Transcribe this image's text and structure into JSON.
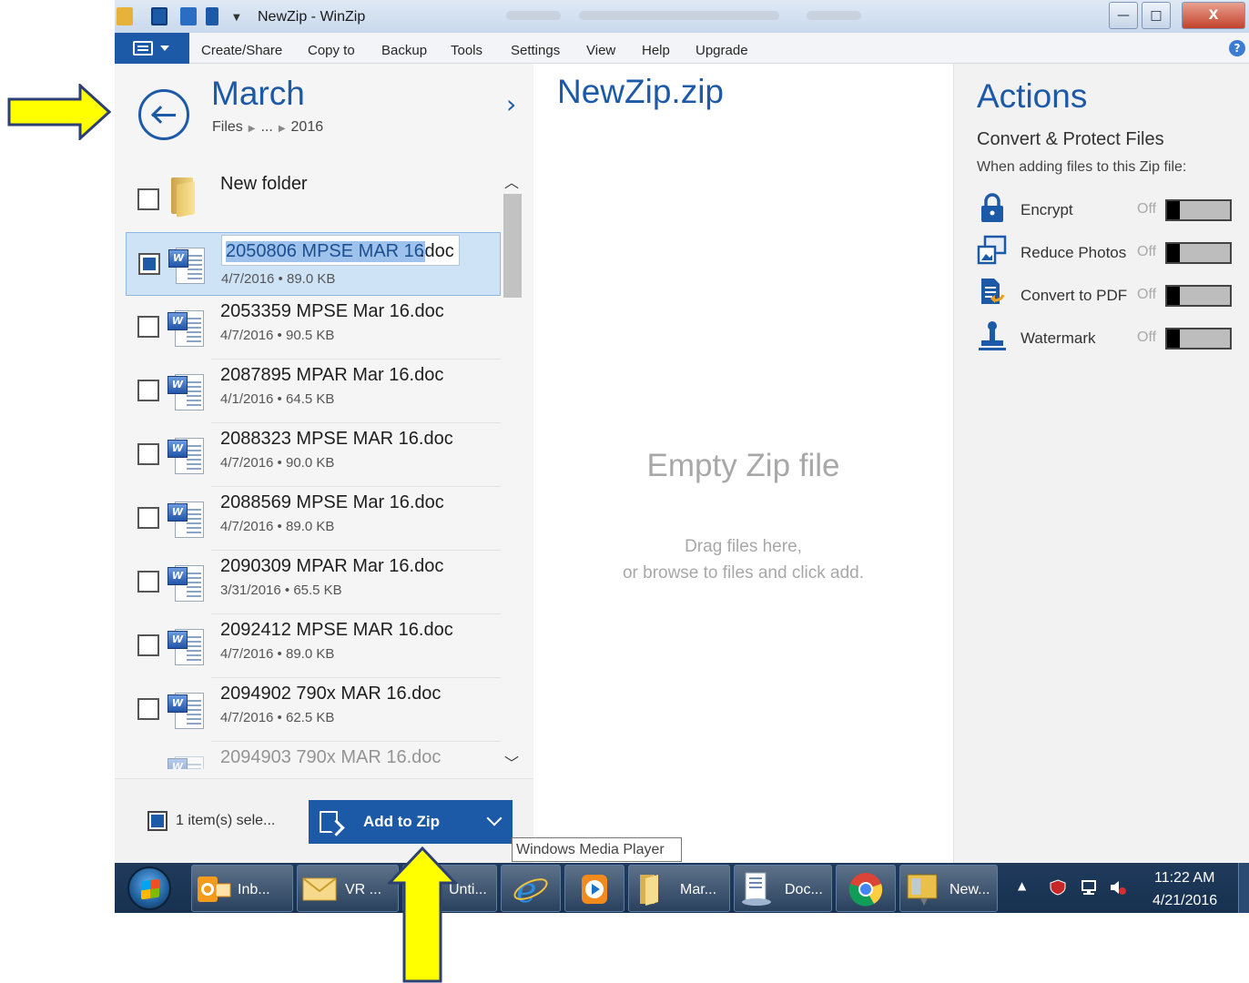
{
  "window": {
    "title": "NewZip - WinZip",
    "min_label": "—",
    "max_label": "□",
    "close_label": "X"
  },
  "menu": {
    "items": [
      "Create/Share",
      "Copy to",
      "Backup",
      "Tools",
      "Settings",
      "View",
      "Help",
      "Upgrade"
    ],
    "help_icon": "?"
  },
  "left": {
    "folder_title": "March",
    "breadcrumb": [
      "Files",
      "...",
      "2016"
    ],
    "files": [
      {
        "name": "New folder",
        "meta": "",
        "type": "folder",
        "checked": false
      },
      {
        "name": "2050806 MPSE MAR 16.doc",
        "name_selected": "2050806 MPSE MAR 16",
        "name_rest": ".doc",
        "meta": "4/7/2016 • 89.0 KB",
        "type": "doc",
        "checked": true,
        "renaming": true
      },
      {
        "name": "2053359 MPSE Mar 16.doc",
        "meta": "4/7/2016 • 90.5 KB",
        "type": "doc",
        "checked": false
      },
      {
        "name": "2087895 MPAR Mar 16.doc",
        "meta": "4/1/2016 • 64.5 KB",
        "type": "doc",
        "checked": false
      },
      {
        "name": "2088323 MPSE MAR 16.doc",
        "meta": "4/7/2016 • 90.0 KB",
        "type": "doc",
        "checked": false
      },
      {
        "name": "2088569 MPSE Mar 16.doc",
        "meta": "4/7/2016 • 89.0 KB",
        "type": "doc",
        "checked": false
      },
      {
        "name": "2090309 MPAR  Mar 16.doc",
        "meta": "3/31/2016 • 65.5 KB",
        "type": "doc",
        "checked": false
      },
      {
        "name": "2092412 MPSE  MAR 16.doc",
        "meta": "4/7/2016 • 89.0 KB",
        "type": "doc",
        "checked": false
      },
      {
        "name": "2094902 790x MAR 16.doc",
        "meta": "4/7/2016 • 62.5 KB",
        "type": "doc",
        "checked": false
      },
      {
        "name": "2094903 790x MAR 16.doc",
        "meta": "",
        "type": "doc",
        "checked": false
      }
    ],
    "selection_text": "1 item(s) sele...",
    "add_button": "Add to Zip"
  },
  "middle": {
    "zip_name": "NewZip.zip",
    "empty_title": "Empty Zip file",
    "hint_line1": "Drag files here,",
    "hint_line2": "or browse to files and click add."
  },
  "right": {
    "title": "Actions",
    "subtitle": "Convert & Protect Files",
    "description": "When adding files to this Zip file:",
    "actions": [
      {
        "label": "Encrypt",
        "state": "Off",
        "icon": "lock-icon"
      },
      {
        "label": "Reduce Photos",
        "state": "Off",
        "icon": "photo-icon"
      },
      {
        "label": "Convert to PDF",
        "state": "Off",
        "icon": "pdf-icon"
      },
      {
        "label": "Watermark",
        "state": "Off",
        "icon": "stamp-icon"
      }
    ]
  },
  "tooltip": "Windows Media Player",
  "taskbar": {
    "buttons": [
      {
        "label": "Inb...",
        "icon": "outlook-icon"
      },
      {
        "label": "VR ...",
        "icon": "mail-icon"
      },
      {
        "label": "Unti...",
        "icon": "document-icon"
      },
      {
        "label": "",
        "icon": "internet-explorer-icon"
      },
      {
        "label": "",
        "icon": "media-player-icon"
      },
      {
        "label": "Mar...",
        "icon": "folder-icon"
      },
      {
        "label": "Doc...",
        "icon": "document-icon"
      },
      {
        "label": "",
        "icon": "chrome-icon"
      },
      {
        "label": "New...",
        "icon": "winzip-icon"
      }
    ],
    "time": "11:22 AM",
    "date": "4/21/2016"
  },
  "colors": {
    "accent": "#1c5aa8",
    "annotation_arrow": "#ffff00"
  }
}
